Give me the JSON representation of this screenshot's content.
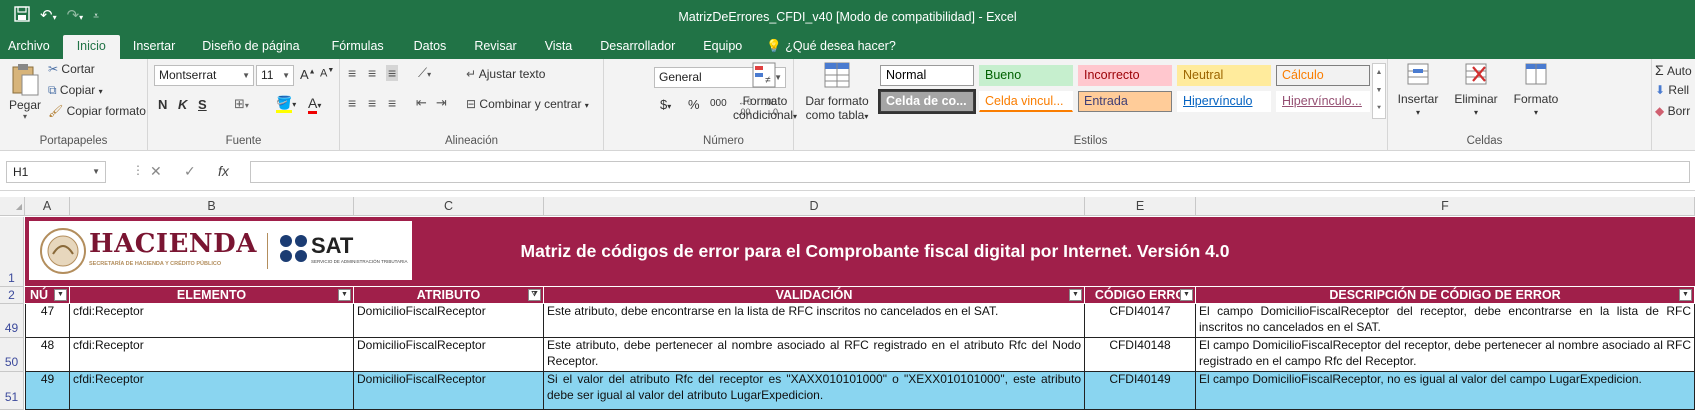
{
  "window": {
    "title": "MatrizDeErrores_CFDI_v40  [Modo de compatibilidad] - Excel"
  },
  "menu": {
    "tabs": [
      "Archivo",
      "Inicio",
      "Insertar",
      "Diseño de página",
      "Fórmulas",
      "Datos",
      "Revisar",
      "Vista",
      "Desarrollador",
      "Equipo"
    ],
    "tell_me": "¿Qué desea hacer?"
  },
  "ribbon": {
    "portapapeles": {
      "label": "Portapapeles",
      "pegar": "Pegar",
      "cortar": "Cortar",
      "copiar": "Copiar",
      "copiar_formato": "Copiar formato"
    },
    "fuente": {
      "label": "Fuente",
      "font_name": "Montserrat",
      "font_size": "11",
      "bold": "N",
      "italic": "K",
      "underline": "S"
    },
    "alineacion": {
      "label": "Alineación",
      "ajustar_texto": "Ajustar texto",
      "combinar": "Combinar y centrar"
    },
    "numero": {
      "label": "Número",
      "format": "General",
      "currency": "$",
      "percent": "%",
      "thousands": "000"
    },
    "estilos": {
      "label": "Estilos",
      "formato_condicional_1": "Formato",
      "formato_condicional_2": "condicional",
      "dar_formato_1": "Dar formato",
      "dar_formato_2": "como tabla",
      "styles": [
        {
          "name": "Normal",
          "bg": "#ffffff",
          "fg": "#000000",
          "border": "#9a9a9a"
        },
        {
          "name": "Bueno",
          "bg": "#c6efce",
          "fg": "#006100",
          "border": "#c6efce"
        },
        {
          "name": "Incorrecto",
          "bg": "#ffc7ce",
          "fg": "#9c0006",
          "border": "#ffc7ce"
        },
        {
          "name": "Neutral",
          "bg": "#ffeb9c",
          "fg": "#9c6500",
          "border": "#ffeb9c"
        },
        {
          "name": "Cálculo",
          "bg": "#f2f2f2",
          "fg": "#fa7d00",
          "border": "#7f7f7f"
        },
        {
          "name": "Celda de co...",
          "bg": "#a5a5a5",
          "fg": "#ffffff",
          "border": "#3f3f3f"
        },
        {
          "name": "Celda vincul...",
          "bg": "#ffffff",
          "fg": "#fa7d00",
          "border": "#ffffff"
        },
        {
          "name": "Entrada",
          "bg": "#ffcc99",
          "fg": "#3f3f76",
          "border": "#7f7f7f"
        },
        {
          "name": "Hipervínculo",
          "bg": "#ffffff",
          "fg": "#0563c1",
          "border": "#ffffff"
        },
        {
          "name": "Hipervínculo...",
          "bg": "#ffffff",
          "fg": "#954f72",
          "border": "#ffffff"
        }
      ]
    },
    "celdas": {
      "label": "Celdas",
      "insertar": "Insertar",
      "eliminar": "Eliminar",
      "formato": "Formato"
    },
    "edicion": {
      "autosuma": "Auto",
      "rellenar": "Rell",
      "borrar": "Borr"
    }
  },
  "formula_bar": {
    "name_box": "H1",
    "fx": "fx",
    "value": ""
  },
  "sheet": {
    "columns": [
      "A",
      "B",
      "C",
      "D",
      "E",
      "F"
    ],
    "row_numbers": [
      "1",
      "2",
      "49",
      "50",
      "51"
    ],
    "banner": {
      "logo_hacienda": "HACIENDA",
      "logo_hacienda_sub": "SECRETARÍA DE HACIENDA Y CRÉDITO PÚBLICO",
      "logo_sat": "SAT",
      "logo_sat_sub": "SERVICIO DE ADMINISTRACIÓN TRIBUTARIA",
      "title": "Matriz de códigos de error para el Comprobante fiscal digital por Internet. Versión 4.0"
    },
    "headers": [
      "NÚ",
      "ELEMENTO",
      "ATRIBUTO",
      "VALIDACIÓN",
      "CÓDIGO ERRO",
      "DESCRIPCIÓN DE CÓDIGO DE ERROR"
    ],
    "rows": [
      {
        "num": "47",
        "elemento": "cfdi:Receptor",
        "atributo": "DomicilioFiscalReceptor",
        "validacion": "Este atributo, debe encontrarse en la lista de RFC inscritos no cancelados en el SAT.",
        "codigo": "CFDI40147",
        "descripcion": "El campo DomicilioFiscalReceptor del receptor, debe encontrarse en la lista de RFC inscritos no cancelados en el SAT."
      },
      {
        "num": "48",
        "elemento": "cfdi:Receptor",
        "atributo": "DomicilioFiscalReceptor",
        "validacion": "Este atributo, debe pertenecer al nombre asociado al RFC registrado en el atributo Rfc del Nodo Receptor.",
        "codigo": "CFDI40148",
        "descripcion": "El campo DomicilioFiscalReceptor del receptor, debe pertenecer al nombre asociado al RFC registrado en el campo Rfc del Receptor."
      },
      {
        "num": "49",
        "elemento": "cfdi:Receptor",
        "atributo": "DomicilioFiscalReceptor",
        "validacion": "Si el valor del atributo Rfc del receptor es \"XAXX010101000\" o \"XEXX010101000\", este atributo debe ser igual al valor del atributo LugarExpedicion.",
        "codigo": "CFDI40149",
        "descripcion": "El campo DomicilioFiscalReceptor, no es igual al valor del campo LugarExpedicion."
      }
    ]
  },
  "colors": {
    "excel_green": "#217346",
    "banner": "#a01f4a",
    "highlight_row": "#8ad5f0"
  }
}
